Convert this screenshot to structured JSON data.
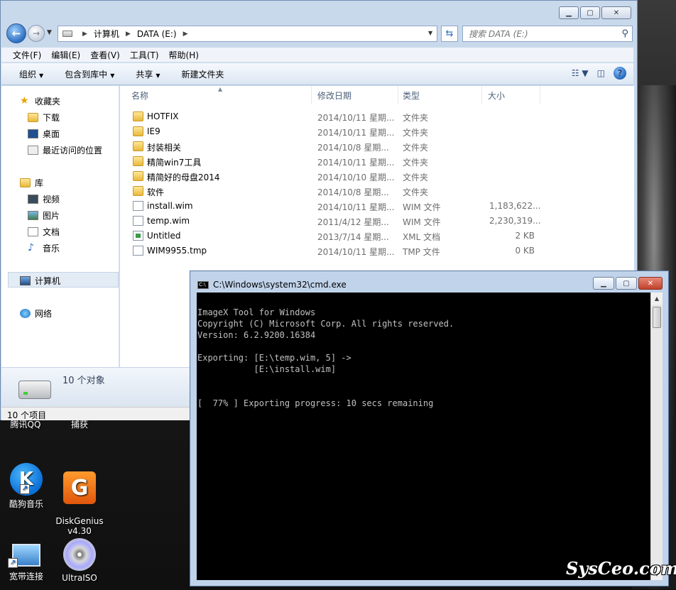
{
  "explorer": {
    "address": {
      "part1": "计算机",
      "part2": "DATA (E:)"
    },
    "search_placeholder": "搜索 DATA (E:)",
    "menu": [
      "文件(F)",
      "编辑(E)",
      "查看(V)",
      "工具(T)",
      "帮助(H)"
    ],
    "toolbar": {
      "organize": "组织",
      "include": "包含到库中",
      "share": "共享",
      "new_folder": "新建文件夹"
    },
    "nav": {
      "favorites": "收藏夹",
      "downloads": "下载",
      "desktop": "桌面",
      "recent": "最近访问的位置",
      "libraries": "库",
      "videos": "视频",
      "pictures": "图片",
      "documents": "文档",
      "music": "音乐",
      "computer": "计算机",
      "network": "网络"
    },
    "columns": {
      "name": "名称",
      "date": "修改日期",
      "type": "类型",
      "size": "大小"
    },
    "files": [
      {
        "name": "HOTFIX",
        "date": "2014/10/11 星期...",
        "type": "文件夹",
        "size": "",
        "icon": "folder"
      },
      {
        "name": "IE9",
        "date": "2014/10/11 星期...",
        "type": "文件夹",
        "size": "",
        "icon": "folder"
      },
      {
        "name": "封装相关",
        "date": "2014/10/8 星期...",
        "type": "文件夹",
        "size": "",
        "icon": "folder"
      },
      {
        "name": "精简win7工具",
        "date": "2014/10/11 星期...",
        "type": "文件夹",
        "size": "",
        "icon": "folder"
      },
      {
        "name": "精简好的母盘2014",
        "date": "2014/10/10 星期...",
        "type": "文件夹",
        "size": "",
        "icon": "folder"
      },
      {
        "name": "软件",
        "date": "2014/10/8 星期...",
        "type": "文件夹",
        "size": "",
        "icon": "folder"
      },
      {
        "name": "install.wim",
        "date": "2014/10/11 星期...",
        "type": "WIM 文件",
        "size": "1,183,622...",
        "icon": "file"
      },
      {
        "name": "temp.wim",
        "date": "2011/4/12 星期...",
        "type": "WIM 文件",
        "size": "2,230,319...",
        "icon": "file"
      },
      {
        "name": "Untitled",
        "date": "2013/7/14 星期...",
        "type": "XML 文档",
        "size": "2 KB",
        "icon": "xml"
      },
      {
        "name": "WIM9955.tmp",
        "date": "2014/10/11 星期...",
        "type": "TMP 文件",
        "size": "0 KB",
        "icon": "file"
      }
    ],
    "details_count": "10 个对象",
    "status": "10 个项目"
  },
  "desktop": {
    "partial_labels": [
      "腾讯QQ",
      "捕获"
    ],
    "icons": [
      {
        "label": "酷狗音乐",
        "glyph": "K"
      },
      {
        "label": "DiskGenius\nv4.30",
        "glyph": "G"
      },
      {
        "label": "宽带连接",
        "glyph": ""
      },
      {
        "label": "UltraISO",
        "glyph": ""
      }
    ]
  },
  "cmd": {
    "title": "C:\\Windows\\system32\\cmd.exe",
    "output": "ImageX Tool for Windows\nCopyright (C) Microsoft Corp. All rights reserved.\nVersion: 6.2.9200.16384\n\nExporting: [E:\\temp.wim, 5] ->\n           [E:\\install.wim]\n\n\n[  77% ] Exporting progress: 10 secs remaining"
  },
  "watermark": "SysCeo.com",
  "colors": {
    "explorer_frame": "#c9d9ec",
    "console_bg": "#000000",
    "console_text": "#c0c0c0"
  }
}
